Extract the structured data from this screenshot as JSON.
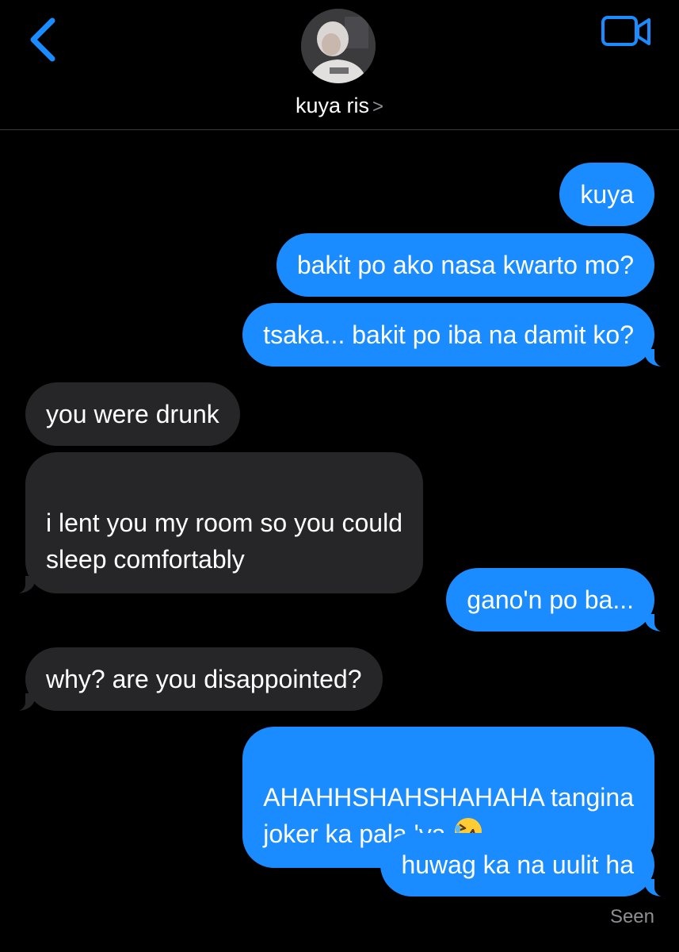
{
  "header": {
    "contact_name": "kuya ris",
    "chevron": ">",
    "back_icon": "chevron-left-icon",
    "video_icon": "video-camera-icon",
    "accent_color": "#1a8cff"
  },
  "messages": [
    {
      "direction": "outgoing",
      "text": "kuya"
    },
    {
      "direction": "outgoing",
      "text": "bakit po ako nasa kwarto mo?"
    },
    {
      "direction": "outgoing",
      "text": "tsaka... bakit po iba na damit ko?"
    },
    {
      "direction": "incoming",
      "text": "you were drunk"
    },
    {
      "direction": "incoming",
      "text": "i lent you my room so you could\nsleep comfortably"
    },
    {
      "direction": "outgoing",
      "text": "gano'n po ba..."
    },
    {
      "direction": "incoming",
      "text": "why? are you disappointed?"
    },
    {
      "direction": "outgoing",
      "text": "AHAHHSHAHSHAHAHA tangina\njoker ka pala 'ya",
      "emoji": "rolling-on-floor-laughing-emoji"
    },
    {
      "direction": "outgoing",
      "text": "huwag ka na uulit ha"
    }
  ],
  "status": {
    "seen_label": "Seen"
  },
  "colors": {
    "outgoing_bubble": "#1a8cff",
    "incoming_bubble": "#262628",
    "background": "#000000",
    "secondary_text": "#8e8e93"
  }
}
